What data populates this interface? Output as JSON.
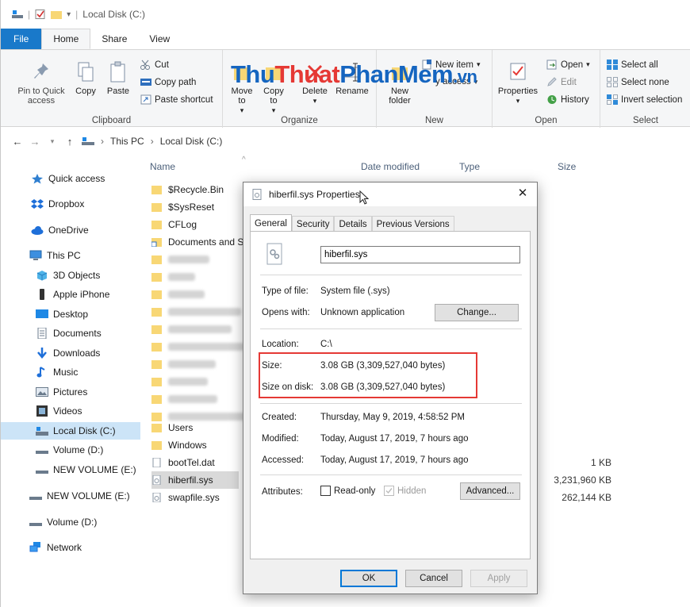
{
  "window": {
    "title": "Local Disk (C:)",
    "tabs": [
      "File",
      "Home",
      "Share",
      "View"
    ]
  },
  "ribbon": {
    "clipboard": {
      "label": "Clipboard",
      "pin": "Pin to Quick access",
      "copy": "Copy",
      "paste": "Paste",
      "cut": "Cut",
      "copy_path": "Copy path",
      "paste_shortcut": "Paste shortcut"
    },
    "organize": {
      "label": "Organize",
      "move_to": "Move to",
      "copy_to": "Copy to",
      "delete": "Delete",
      "rename": "Rename"
    },
    "new": {
      "label": "New",
      "new_item": "New item",
      "easy_access": "y access",
      "new_folder": "New folder"
    },
    "open": {
      "label": "Open",
      "properties": "Properties",
      "open": "Open",
      "edit": "Edit",
      "history": "History"
    },
    "select": {
      "label": "Select",
      "select_all": "Select all",
      "select_none": "Select none",
      "invert_selection": "Invert selection"
    }
  },
  "watermark": {
    "part1": "Thu",
    "part2": "Thuat",
    "part3": "PhanMem",
    "part4": ".vn"
  },
  "address": {
    "crumbs": [
      "This PC",
      "Local Disk (C:)"
    ]
  },
  "columns": {
    "name": "Name",
    "date_modified": "Date modified",
    "type": "Type",
    "size": "Size"
  },
  "nav": {
    "items": [
      "Quick access",
      "Dropbox",
      "OneDrive",
      "This PC",
      "3D Objects",
      "Apple iPhone",
      "Desktop",
      "Documents",
      "Downloads",
      "Music",
      "Pictures",
      "Videos",
      "Local Disk (C:)",
      "Volume (D:)",
      "NEW VOLUME (E:)",
      "NEW VOLUME (E:)",
      "Volume (D:)",
      "Network"
    ]
  },
  "files": {
    "visible": [
      {
        "name": "$Recycle.Bin",
        "size": ""
      },
      {
        "name": "$SysReset",
        "size": ""
      },
      {
        "name": "CFLog",
        "size": ""
      },
      {
        "name": "Documents and S",
        "size": ""
      }
    ],
    "lower": [
      {
        "name": "Users",
        "size": ""
      },
      {
        "name": "Windows",
        "size": ""
      },
      {
        "name": "bootTel.dat",
        "size": "1 KB"
      },
      {
        "name": "hiberfil.sys",
        "size": "3,231,960 KB"
      },
      {
        "name": "swapfile.sys",
        "size": "262,144 KB"
      }
    ]
  },
  "dialog": {
    "title": "hiberfil.sys Properties",
    "tabs": [
      "General",
      "Security",
      "Details",
      "Previous Versions"
    ],
    "file_name": "hiberfil.sys",
    "type_label": "Type of file:",
    "type_value": "System file (.sys)",
    "opens_label": "Opens with:",
    "opens_value": "Unknown application",
    "change_button": "Change...",
    "location_label": "Location:",
    "location_value": "C:\\",
    "size_label": "Size:",
    "size_value": "3.08 GB (3,309,527,040 bytes)",
    "size_on_disk_label": "Size on disk:",
    "size_on_disk_value": "3.08 GB (3,309,527,040 bytes)",
    "created_label": "Created:",
    "created_value": "Thursday, May 9, 2019, 4:58:52 PM",
    "modified_label": "Modified:",
    "modified_value": "Today, August 17, 2019, 7 hours ago",
    "accessed_label": "Accessed:",
    "accessed_value": "Today, August 17, 2019, 7 hours ago",
    "attributes_label": "Attributes:",
    "readonly_label": "Read-only",
    "hidden_label": "Hidden",
    "advanced_button": "Advanced...",
    "ok_button": "OK",
    "cancel_button": "Cancel",
    "apply_button": "Apply"
  },
  "colors": {
    "accent": "#1979ca",
    "highlight": "#e53935",
    "selected_nav": "#cce4f7",
    "folder": "#f8d775"
  }
}
